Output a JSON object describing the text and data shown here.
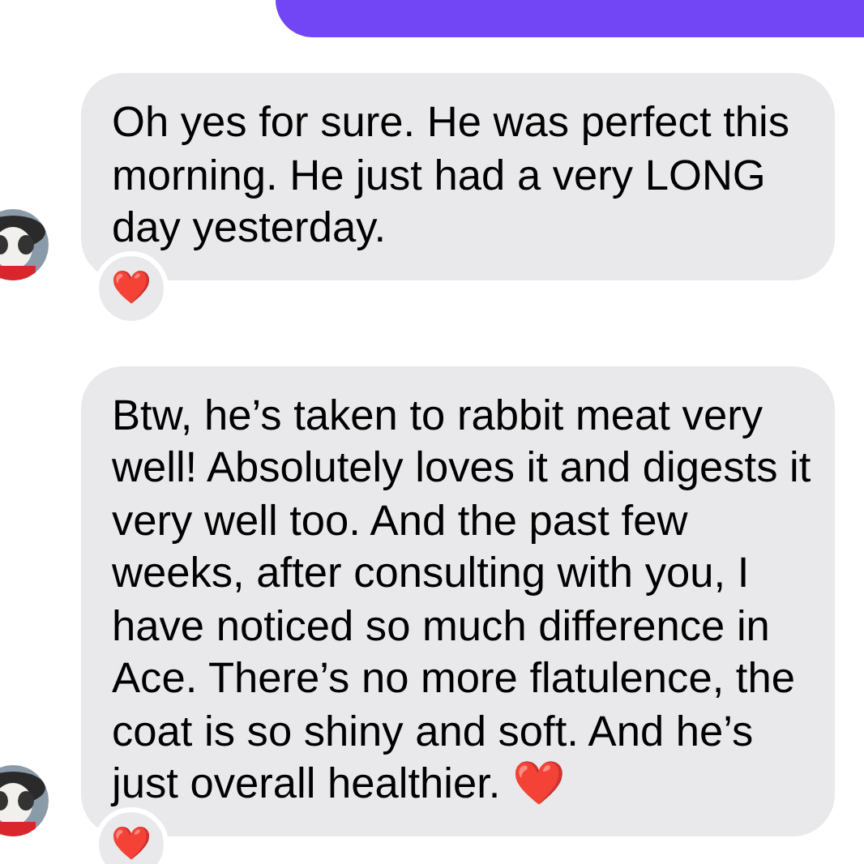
{
  "outgoing": {
    "kind": "bubble"
  },
  "messages": [
    {
      "text": "Oh yes for sure. He was perfect this morning. He just had a very LONG day yesterday.",
      "reaction": "❤️"
    },
    {
      "text": "Btw, he’s taken to rabbit meat very well! Absolutely loves it and digests it very well too. And the past few weeks, after consulting with you, I have noticed so much difference in Ace. There’s no more flatulence, the coat is so shiny and soft. And he’s just overall healthier. ❤️",
      "reaction": "❤️"
    }
  ]
}
